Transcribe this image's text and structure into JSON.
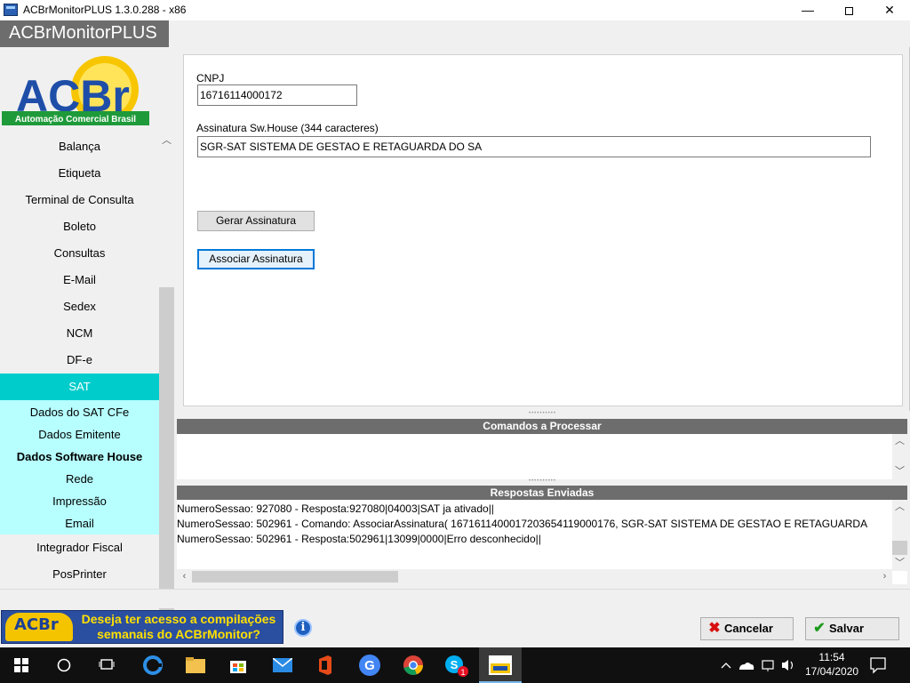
{
  "window": {
    "title": "ACBrMonitorPLUS 1.3.0.288 - x86",
    "min_glyph": "—",
    "close_glyph": "✕"
  },
  "app_name": "ACBrMonitorPLUS",
  "logo": {
    "text": "ACBr",
    "tagline": "Automação Comercial Brasil"
  },
  "sidebar": {
    "items": [
      {
        "label": "Balança"
      },
      {
        "label": "Etiqueta"
      },
      {
        "label": "Terminal de Consulta"
      },
      {
        "label": "Boleto"
      },
      {
        "label": "Consultas"
      },
      {
        "label": "E-Mail"
      },
      {
        "label": "Sedex"
      },
      {
        "label": "NCM"
      },
      {
        "label": "DF-e"
      },
      {
        "label": "SAT"
      }
    ],
    "sat_subitems": [
      {
        "label": "Dados do SAT CFe"
      },
      {
        "label": "Dados Emitente"
      },
      {
        "label": "Dados Software House"
      },
      {
        "label": "Rede"
      },
      {
        "label": "Impressão"
      },
      {
        "label": "Email"
      }
    ],
    "items_after": [
      {
        "label": "Integrador Fiscal"
      },
      {
        "label": "PosPrinter"
      }
    ],
    "active": "SAT",
    "current_subitem": "Dados Software House"
  },
  "form": {
    "cnpj_label": "CNPJ",
    "cnpj_value": "16716114000172",
    "signature_label": "Assinatura Sw.House (344 caracteres)",
    "signature_value": "SGR-SAT SISTEMA DE GESTAO E RETAGUARDA DO SA",
    "gerar_button": "Gerar Assinatura",
    "associar_button": "Associar Assinatura"
  },
  "commands_panel": {
    "title": "Comandos a Processar"
  },
  "responses_panel": {
    "title": "Respostas Enviadas",
    "lines": [
      "NumeroSessao: 927080 - Resposta:927080|04003|SAT ja ativado||",
      "NumeroSessao: 502961 - Comando: AssociarAssinatura( 16716114000172036541190001​76, SGR-SAT SISTEMA DE GESTAO E RETAGUARDA",
      "NumeroSessao: 502961 - Resposta:502961|13099|0000|Erro desconhecido||"
    ]
  },
  "footer": {
    "banner_logo": "ACBr",
    "banner_text": "Deseja ter acesso a compilações semanais do ACBrMonitor?",
    "info_glyph": "i",
    "cancel_label": "Cancelar",
    "save_label": "Salvar"
  },
  "taskbar": {
    "time": "11:54",
    "date": "17/04/2020"
  },
  "colors": {
    "active_nav": "#00cccc",
    "sub_nav_bg": "#b7ffff",
    "panel_header": "#6d6d6d",
    "banner_bg": "#2a4ea0",
    "banner_text": "#ffe000"
  }
}
